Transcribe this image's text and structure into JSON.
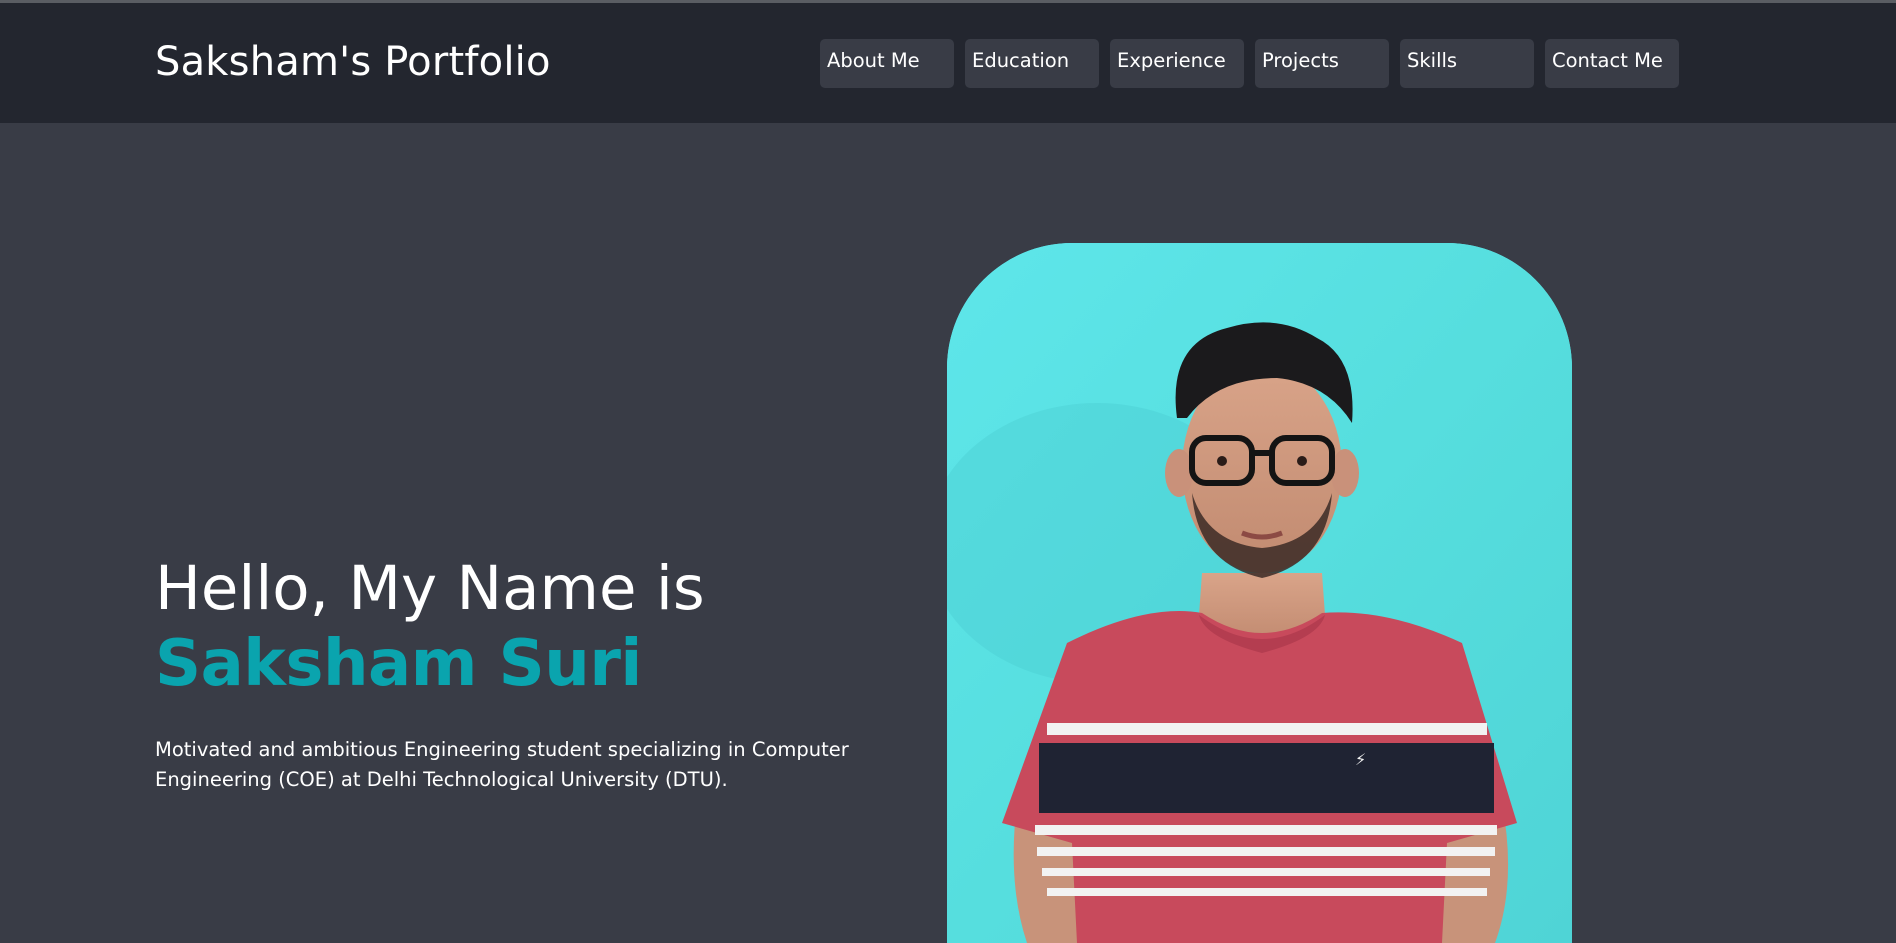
{
  "site": {
    "brand": "Saksham's Portfolio"
  },
  "nav": {
    "items": [
      {
        "label": "About Me"
      },
      {
        "label": "Education"
      },
      {
        "label": "Experience"
      },
      {
        "label": "Projects"
      },
      {
        "label": "Skills"
      },
      {
        "label": "Contact Me"
      }
    ]
  },
  "hero": {
    "greeting": "Hello, My Name is",
    "name": "Saksham Suri",
    "bio": "Motivated and ambitious Engineering student specializing in Computer Engineering (COE) at Delhi Technological University (DTU)."
  },
  "colors": {
    "page_bg": "#393c46",
    "navbar_bg": "#23262f",
    "accent": "#0aa4ae",
    "photo_bg": "#5ee2e2"
  }
}
